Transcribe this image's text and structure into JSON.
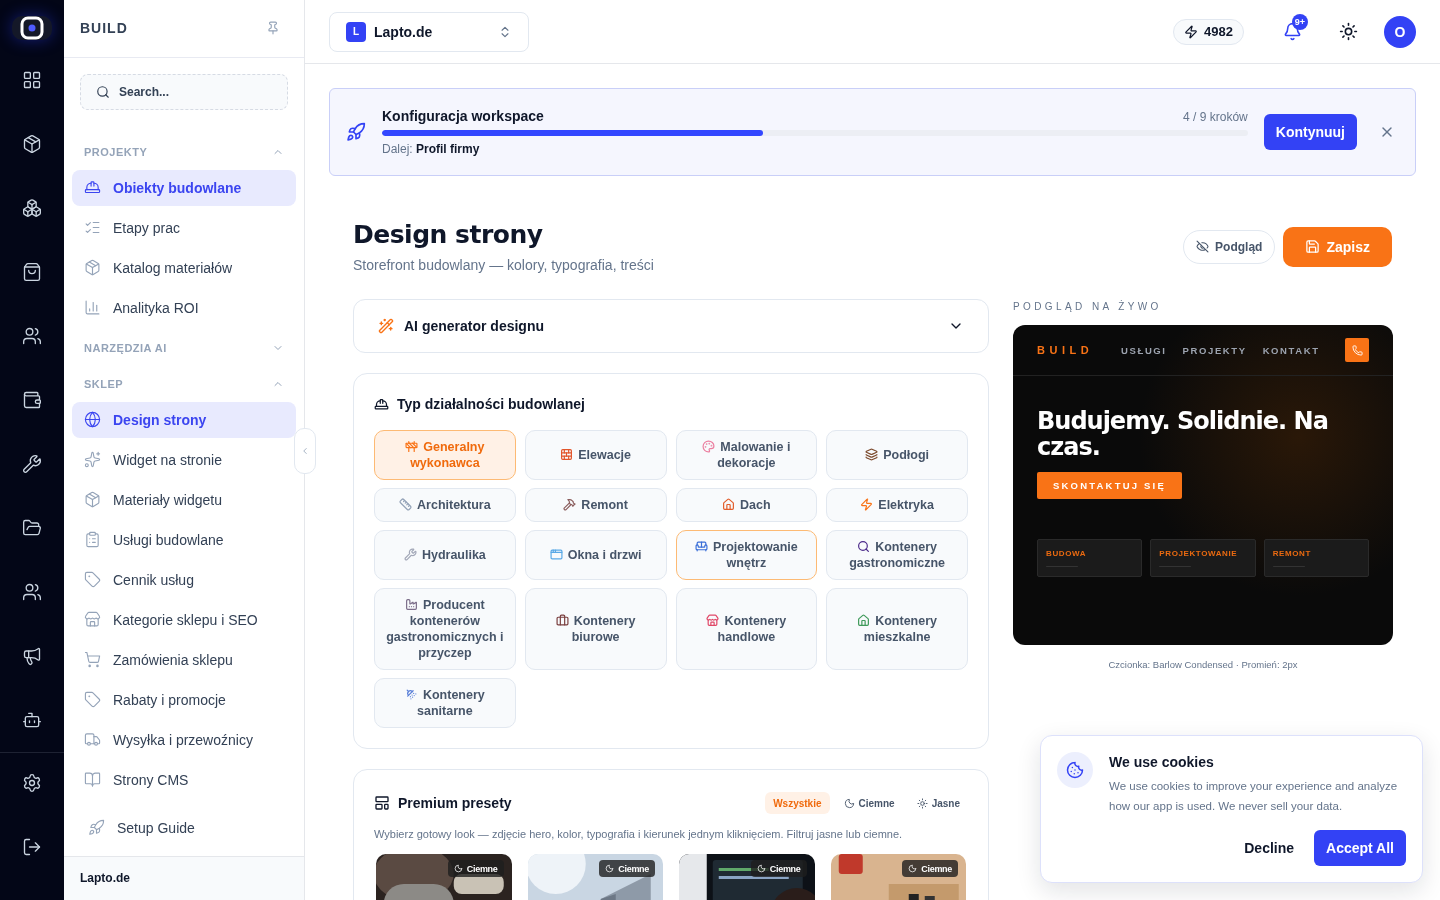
{
  "brand": "BUILD",
  "search": {
    "placeholder": "Search..."
  },
  "sidebar": {
    "sections": [
      {
        "title": "PROJEKTY",
        "expanded": true,
        "items": [
          {
            "label": "Obiekty budowlane",
            "selected": true
          },
          {
            "label": "Etapy prac",
            "selected": false
          },
          {
            "label": "Katalog materiałów",
            "selected": false
          },
          {
            "label": "Analityka ROI",
            "selected": false
          }
        ]
      },
      {
        "title": "NARZĘDZIA AI",
        "expanded": false
      },
      {
        "title": "SKLEP",
        "expanded": true,
        "items": [
          {
            "label": "Design strony",
            "selected": true
          },
          {
            "label": "Widget na stronie",
            "selected": false
          },
          {
            "label": "Materiały widgetu",
            "selected": false
          },
          {
            "label": "Usługi budowlane",
            "selected": false
          },
          {
            "label": "Cennik usług",
            "selected": false
          },
          {
            "label": "Kategorie sklepu i SEO",
            "selected": false
          },
          {
            "label": "Zamówienia sklepu",
            "selected": false
          },
          {
            "label": "Rabaty i promocje",
            "selected": false
          },
          {
            "label": "Wysyłka i przewoźnicy",
            "selected": false
          },
          {
            "label": "Strony CMS",
            "selected": false
          }
        ]
      }
    ],
    "setup_guide": "Setup Guide",
    "footer": "Lapto.de"
  },
  "topbar": {
    "workspace": {
      "initial": "L",
      "name": "Lapto.de"
    },
    "credits": "4982",
    "notifications": "9+",
    "avatar": "O"
  },
  "setup": {
    "title": "Konfiguracja workspace",
    "steps": "4 / 9 kroków",
    "level": 0.44,
    "next": "Dalej: **Profil firmy**",
    "button": "Kontynuuj"
  },
  "page": {
    "title": "Design strony",
    "subtitle": "Storefront budowlany — kolory, typografia, treści",
    "actions": [
      {
        "label": "Podgląd",
        "kind": "secondary"
      },
      {
        "label": "Zapisz",
        "kind": "primary"
      }
    ]
  },
  "ai_generator": {
    "title": "AI generator designu",
    "expanded": false
  },
  "business_types": {
    "title": "Typ działalności budowlanej",
    "options": [
      {
        "label": "Generalny wykonawca",
        "selected": true,
        "accented": false
      },
      {
        "label": "Elewacje",
        "selected": false,
        "accented": false
      },
      {
        "label": "Malowanie i dekoracje",
        "selected": false,
        "accented": false
      },
      {
        "label": "Podłogi",
        "selected": false,
        "accented": false
      },
      {
        "label": "Architektura",
        "selected": false,
        "accented": false
      },
      {
        "label": "Remont",
        "selected": false,
        "accented": false
      },
      {
        "label": "Dach",
        "selected": false,
        "accented": false
      },
      {
        "label": "Elektryka",
        "selected": false,
        "accented": false
      },
      {
        "label": "Hydraulika",
        "selected": false,
        "accented": false
      },
      {
        "label": "Okna i drzwi",
        "selected": false,
        "accented": false
      },
      {
        "label": "Projektowanie wnętrz",
        "selected": false,
        "accented": true
      },
      {
        "label": "Kontenery gastronomiczne",
        "selected": false,
        "accented": false
      },
      {
        "label": "Producent kontenerów gastronomicznych i przyczep",
        "selected": false,
        "accented": false
      },
      {
        "label": "Kontenery biurowe",
        "selected": false,
        "accented": false
      },
      {
        "label": "Kontenery handlowe",
        "selected": false,
        "accented": false
      },
      {
        "label": "Kontenery mieszkalne",
        "selected": false,
        "accented": false
      },
      {
        "label": "Kontenery sanitarne",
        "selected": false,
        "accented": false
      }
    ]
  },
  "presets": {
    "title": "Premium presety",
    "filters": [
      {
        "label": "Wszystkie",
        "kind": "all",
        "selected": true
      },
      {
        "label": "Ciemne",
        "kind": "dark",
        "selected": false
      },
      {
        "label": "Jasne",
        "kind": "light",
        "selected": false
      }
    ],
    "description": "Wybierz gotowy look — zdjęcie hero, kolor, typografia i kierunek jednym kliknięciem. Filtruj jasne lub ciemne.",
    "cards": [
      {
        "kind": "picture",
        "badge": "Ciemne"
      },
      {
        "kind": "picture",
        "badge": "Ciemne"
      },
      {
        "kind": "picture",
        "badge": "Ciemne"
      },
      {
        "kind": "picture",
        "badge": "Ciemne"
      }
    ]
  },
  "preview": {
    "label": "PODGLĄD NA ŻYWO",
    "brand": "BUILD",
    "nav": [
      "USŁUGI",
      "PROJEKTY",
      "KONTAKT"
    ],
    "headline": "Budujemy. Solidnie. Na czas.",
    "cta": "SKONTAKTUJ SIĘ",
    "services": [
      "BUDOWA",
      "PROJEKTOWANIE",
      "REMONT"
    ],
    "caption": "Czcionka: Barlow Condensed · Promień: 2px"
  },
  "cookies": {
    "title": "We use cookies",
    "text": "We use cookies to improve your experience and analyze how our app is used. We never sell your data.",
    "decline": "Decline",
    "accept": "Accept All"
  }
}
